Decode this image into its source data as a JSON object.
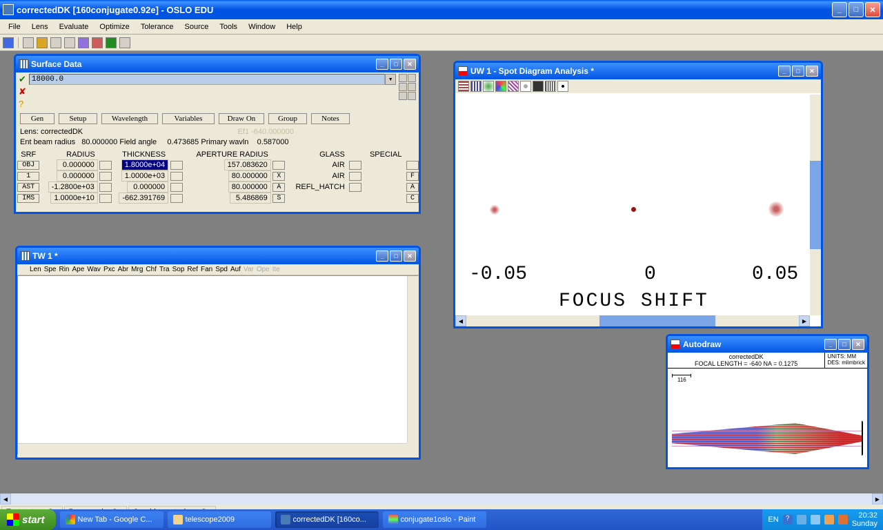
{
  "app": {
    "title": "correctedDK [160conjugate0.92e] - OSLO EDU"
  },
  "menu": [
    "File",
    "Lens",
    "Evaluate",
    "Optimize",
    "Tolerance",
    "Source",
    "Tools",
    "Window",
    "Help"
  ],
  "surface": {
    "title": "Surface Data",
    "input_value": "18000.0",
    "buttons": [
      "Gen",
      "Setup",
      "Wavelength",
      "Variables",
      "Draw On",
      "Group",
      "Notes"
    ],
    "lens_line": "Lens: correctedDK",
    "efl_faded": "Ef1 -640.000000",
    "beam_line": "Ent beam radius   80.000000 Field angle     0.473685 Primary wavln    0.587000",
    "headers": {
      "srf": "SRF",
      "radius": "RADIUS",
      "thickness": "THICKNESS",
      "aperture": "APERTURE RADIUS",
      "glass": "GLASS",
      "special": "SPECIAL"
    },
    "rows": [
      {
        "srf": "OBJ",
        "radius": "0.000000",
        "thickness": "1.8000e+04",
        "thickness_sel": true,
        "aperture": "157.083620",
        "ap_btn": "",
        "glass": "AIR",
        "special": ""
      },
      {
        "srf": "1",
        "radius": "0.000000",
        "thickness": "1.0000e+03",
        "aperture": "80.000000",
        "ap_btn": "X",
        "glass": "AIR",
        "special": "F"
      },
      {
        "srf": "AST",
        "radius": "-1.2800e+03",
        "thickness": "0.000000",
        "aperture": "80.000000",
        "ap_btn": "A",
        "glass": "REFL_HATCH",
        "special": "A"
      },
      {
        "srf": "IMS",
        "radius": "1.0000e+10",
        "thickness": "-662.391769",
        "aperture": "5.486869",
        "ap_btn": "S",
        "glass": "",
        "special": "C"
      }
    ]
  },
  "tw": {
    "title": "TW 1 *",
    "tabs": [
      "Len",
      "Spe",
      "Rin",
      "Ape",
      "Wav",
      "Pxc",
      "Abr",
      "Mrg",
      "Chf",
      "Tra",
      "Sop",
      "Ref",
      "Fan",
      "Spd",
      "Auf"
    ],
    "tabs_disabled": [
      "Var",
      "Ope",
      "Ite"
    ]
  },
  "uw": {
    "title": "UW 1 - Spot Diagram Analysis *",
    "focus_label": "FOCUS SHIFT",
    "ticks": {
      "left": "-0.05",
      "center": "0",
      "right": "0.05"
    }
  },
  "autodraw": {
    "title": "Autodraw",
    "name": "correctedDK",
    "info": "FOCAL LENGTH = -640   NA = 0.1275",
    "units": "UNITS: MM",
    "des": "DES: mlimbrick",
    "scale": "116"
  },
  "status": {
    "text_output": "Text output: On",
    "page_mode": "Page mode: On",
    "graphics": "Graphics autoclear: On"
  },
  "taskbar": {
    "start": "start",
    "items": [
      {
        "label": "New Tab - Google C...",
        "active": false
      },
      {
        "label": "telescope2009",
        "active": false
      },
      {
        "label": "correctedDK [160co...",
        "active": true
      },
      {
        "label": "conjugate1oslo - Paint",
        "active": false
      }
    ],
    "lang": "EN",
    "time": "20:32",
    "day": "Sunday"
  }
}
